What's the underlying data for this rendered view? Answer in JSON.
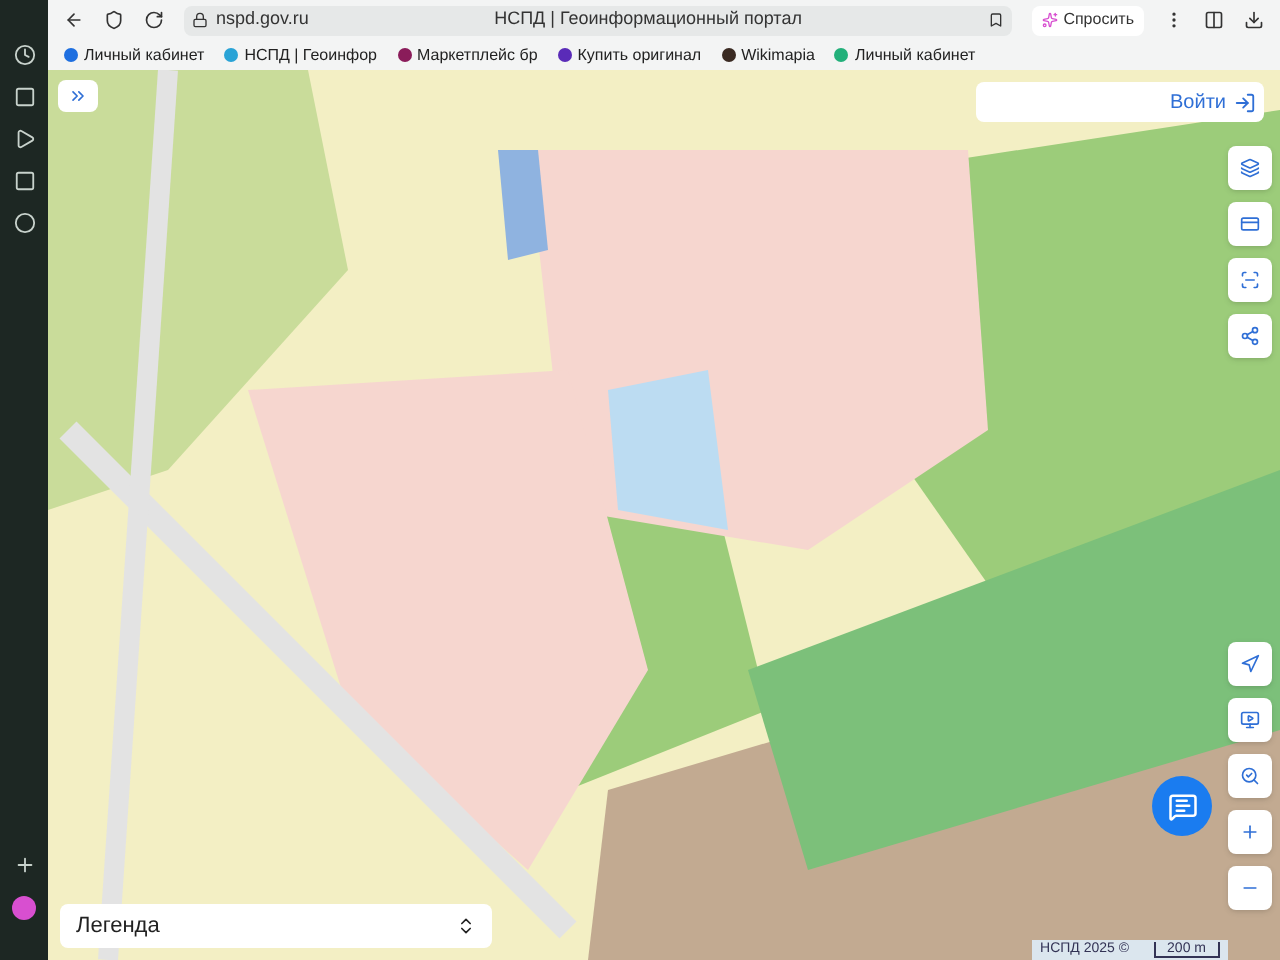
{
  "browser": {
    "address": "nspd.gov.ru",
    "title": "НСПД | Геоинформационный портал",
    "ask_button": "Спросить",
    "bookmarks": [
      {
        "label": "Личный кабинет",
        "color": "#1e6fe0"
      },
      {
        "label": "НСПД | Геоинфор",
        "color": "#29a3d6"
      },
      {
        "label": "Маркетплейс бр",
        "color": "#8a1c5a"
      },
      {
        "label": "Купить оригинал",
        "color": "#5a2bb8"
      },
      {
        "label": "Wikimapia",
        "color": "#3a2a22"
      },
      {
        "label": "Личный кабинет",
        "color": "#22b07a"
      }
    ]
  },
  "map": {
    "login_button": "Войти",
    "legend": "Легенда",
    "attribution": "НСПД 2025 ©",
    "scale": "200 m"
  }
}
